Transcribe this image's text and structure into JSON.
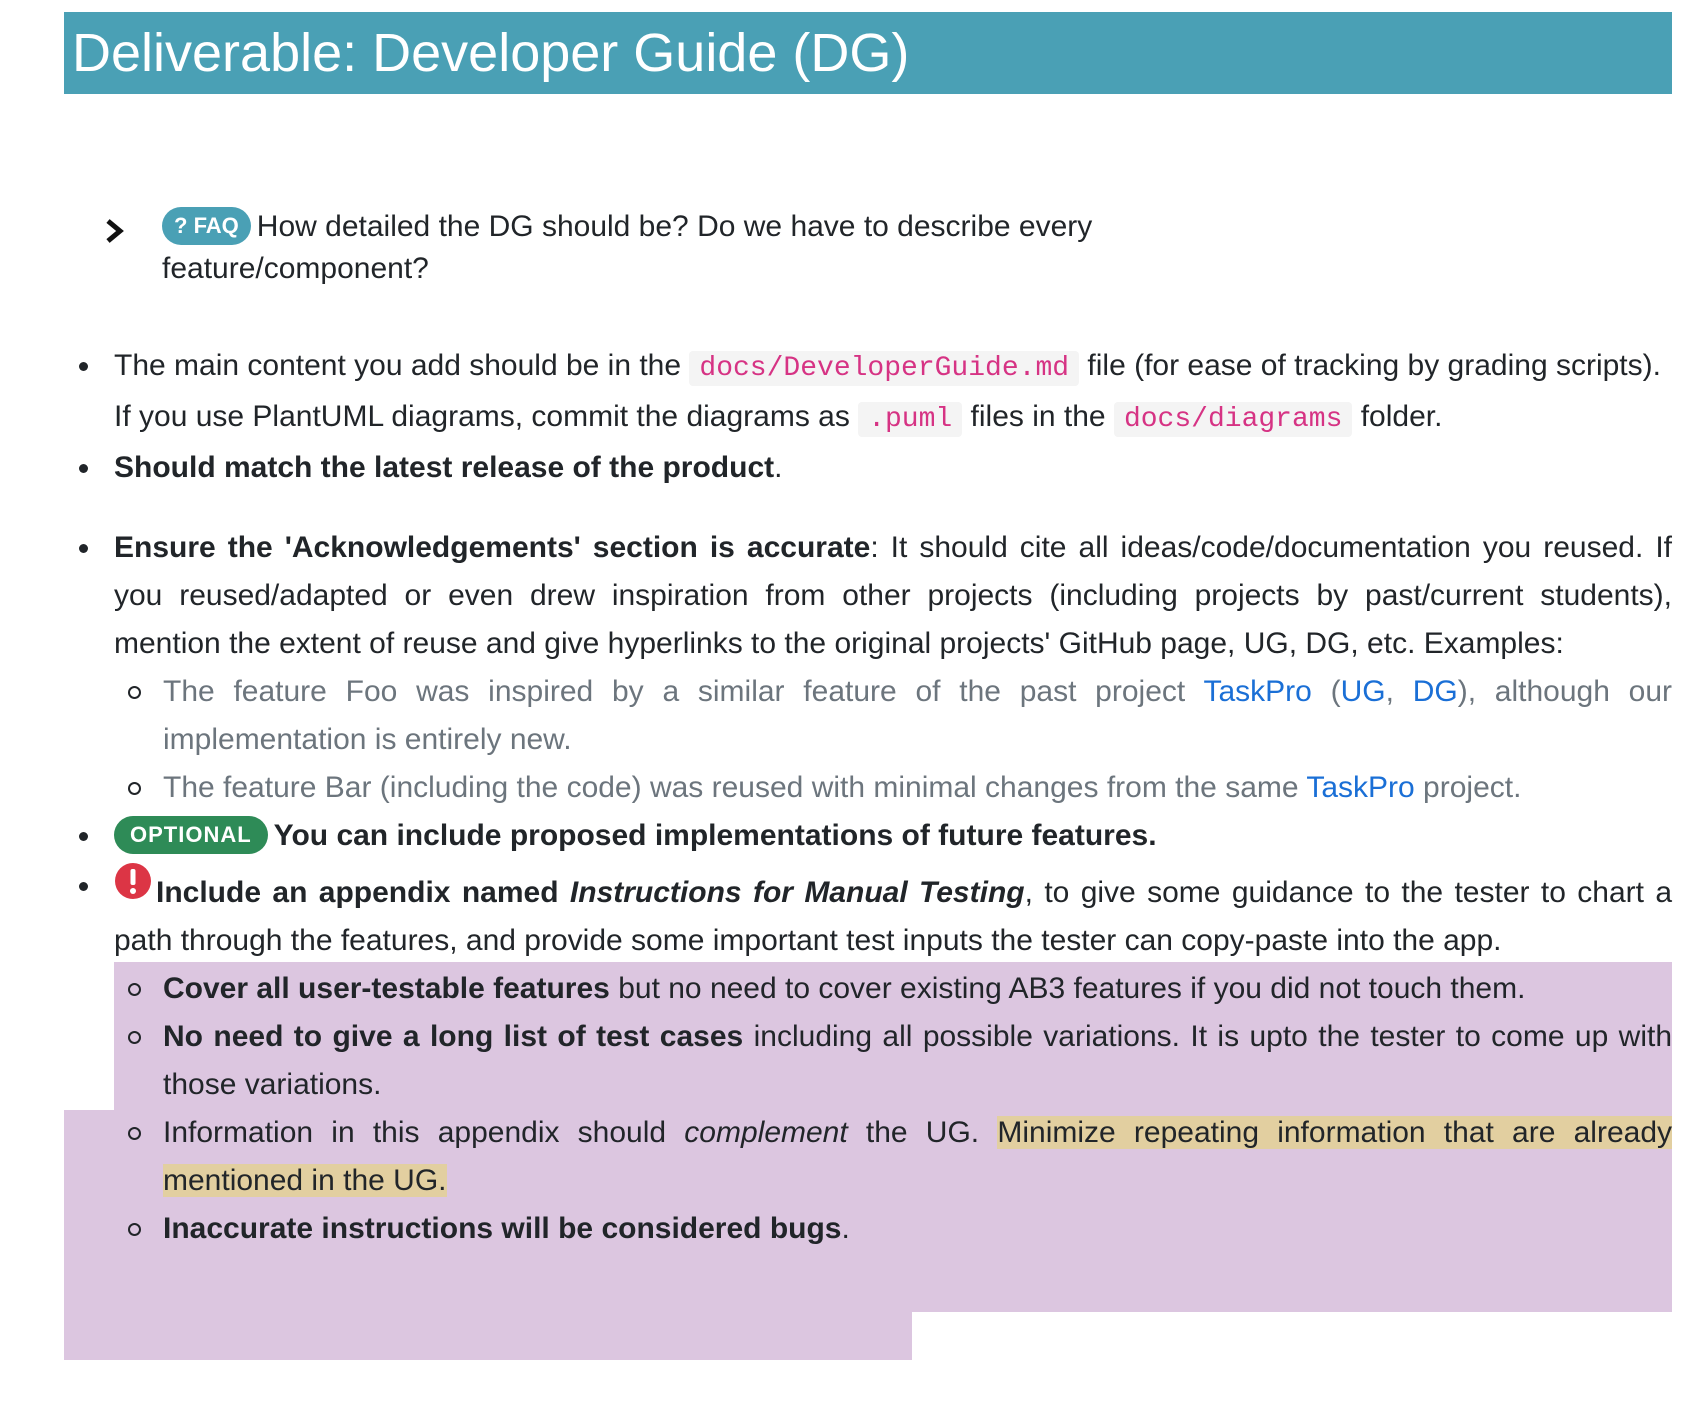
{
  "header": {
    "title": "Deliverable: Developer Guide (DG)"
  },
  "faq": {
    "badge": "FAQ",
    "question": "How detailed the DG should be? Do we have to describe every feature/component?"
  },
  "item1": {
    "text_a": "The main content you add should be in the ",
    "code_a": "docs/DeveloperGuide.md",
    "text_b": " file (for ease of tracking by grading scripts).",
    "text_c": "If you use PlantUML diagrams, commit the diagrams as ",
    "code_b": ".puml",
    "text_d": " files in the ",
    "code_c": "docs/diagrams",
    "text_e": " folder."
  },
  "item2": {
    "bold": "Should match the latest release of the product",
    "tail": "."
  },
  "item3": {
    "bold": "Ensure the 'Acknowledgements' section is accurate",
    "text": ": It should cite all ideas/code/documentation you reused. If you reused/adapted or even drew inspiration from other projects (including projects by past/current students), mention the extent of reuse and give hyperlinks to the original projects' GitHub page, UG, DG, etc. Examples:",
    "sub1_a": "The feature Foo was inspired by a similar feature of the past project ",
    "sub1_link1": "TaskPro",
    "sub1_b": " (",
    "sub1_link2": "UG",
    "sub1_c": ", ",
    "sub1_link3": "DG",
    "sub1_d": "), although our implementation is entirely new.",
    "sub2_a": "The feature Bar (including the code) was reused with minimal changes from the same ",
    "sub2_link": "TaskPro",
    "sub2_b": " project."
  },
  "item4": {
    "badge": "OPTIONAL",
    "bold": "You can include proposed implementations of future features."
  },
  "item5": {
    "bold_a": "Include an appendix named ",
    "bold_italic": "Instructions for Manual Testing",
    "text": ", to give some guidance to the tester to chart a path through the features, and provide some important test inputs the tester can copy-paste into the app.",
    "sub1_bold": "Cover all user-testable features",
    "sub1_text": " but no need to cover existing AB3 features if you did not touch them.",
    "sub2_bold": "No need to give a long list of test cases",
    "sub2_text": " including all possible variations. It is upto the tester to come up with those variations.",
    "sub3_a": "Information in this appendix should ",
    "sub3_italic": "complement",
    "sub3_b": " the UG. ",
    "sub3_hl": "Minimize repeating information that are already mentioned in the UG.",
    "sub4_bold": "Inaccurate instructions will be considered bugs",
    "sub4_tail": "."
  },
  "colors": {
    "header_bg": "#4aa0b5",
    "optional_badge": "#2e8b57",
    "link": "#1a6fd6",
    "code": "#d63384",
    "highlight_purple": "#dcc6e0",
    "highlight_yellow": "#e2cfa0",
    "warning_red": "#dc3545"
  }
}
